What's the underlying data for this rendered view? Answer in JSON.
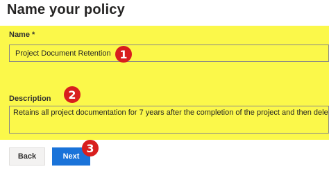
{
  "page": {
    "title": "Name your policy"
  },
  "form": {
    "name_label": "Name *",
    "name_value": "Project Document Retention",
    "description_label": "Description",
    "description_value": "Retains all project documentation for 7 years after the completion of the project and then deletes it"
  },
  "annotations": {
    "marker_1": "1",
    "marker_2": "2",
    "marker_3": "3"
  },
  "buttons": {
    "back_label": "Back",
    "next_label": "Next"
  },
  "colors": {
    "highlight": "#fbf84a",
    "marker": "#d81e1e",
    "primary_button": "#1a73d9"
  }
}
